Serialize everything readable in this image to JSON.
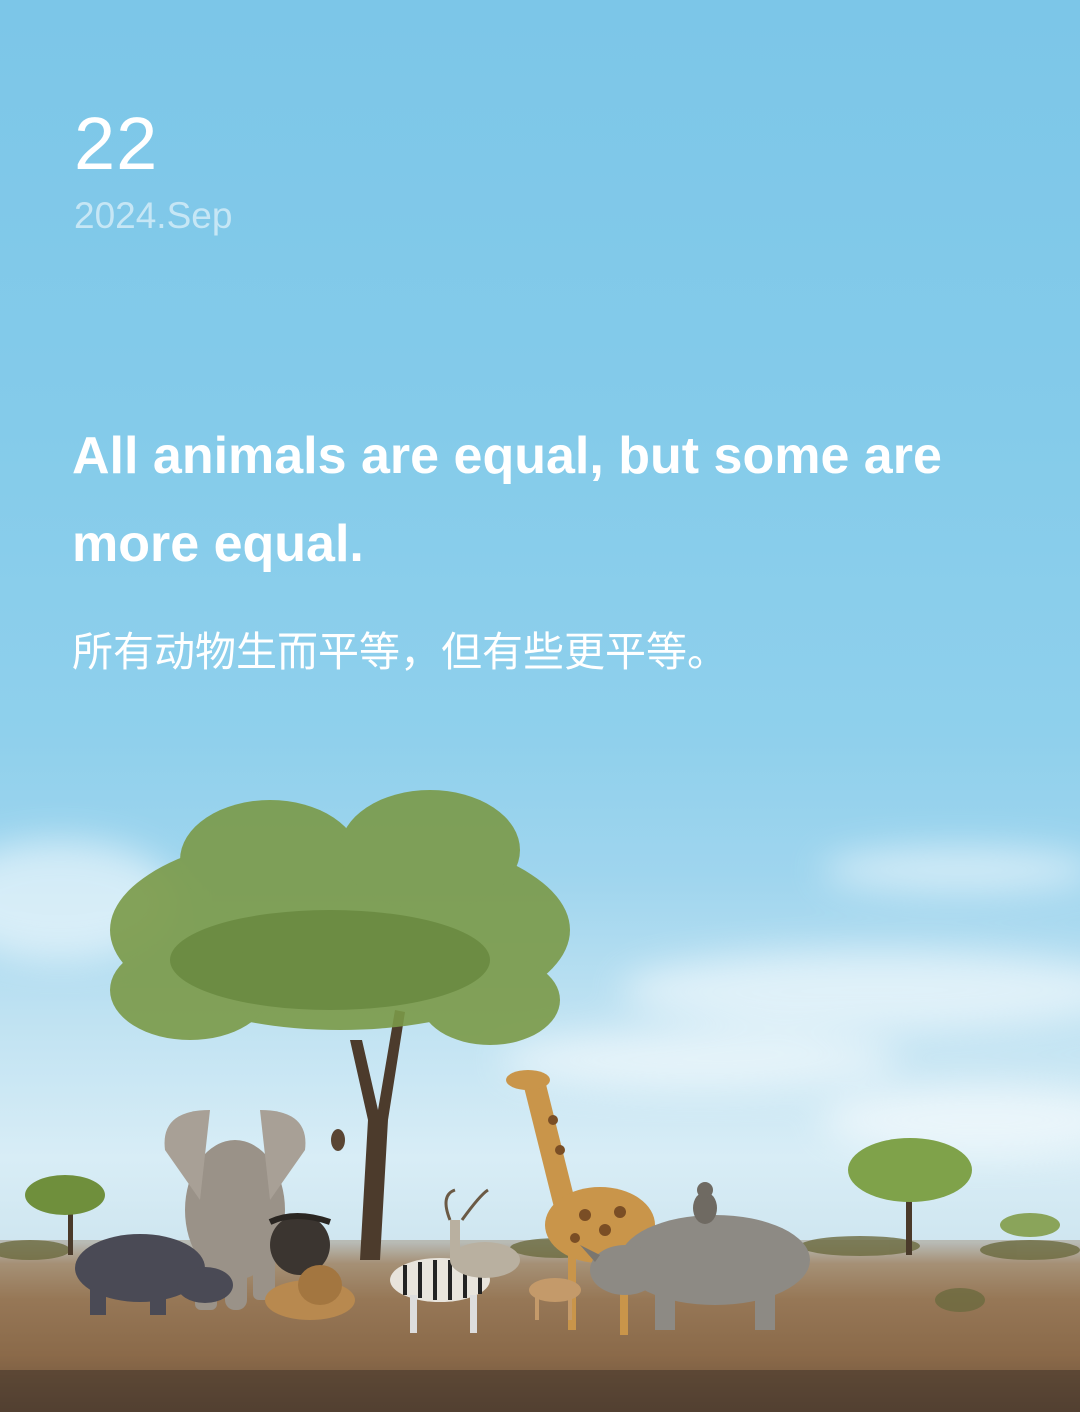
{
  "date": {
    "day": "22",
    "month_year": "2024.Sep"
  },
  "quote": {
    "english": "All animals are equal, but some are more equal.",
    "chinese": "所有动物生而平等，但有些更平等。"
  },
  "colors": {
    "sky_top": "#7cc6e8",
    "sky_horizon": "#d8edf6",
    "ground": "#8a6a4b",
    "text": "#ffffff"
  }
}
